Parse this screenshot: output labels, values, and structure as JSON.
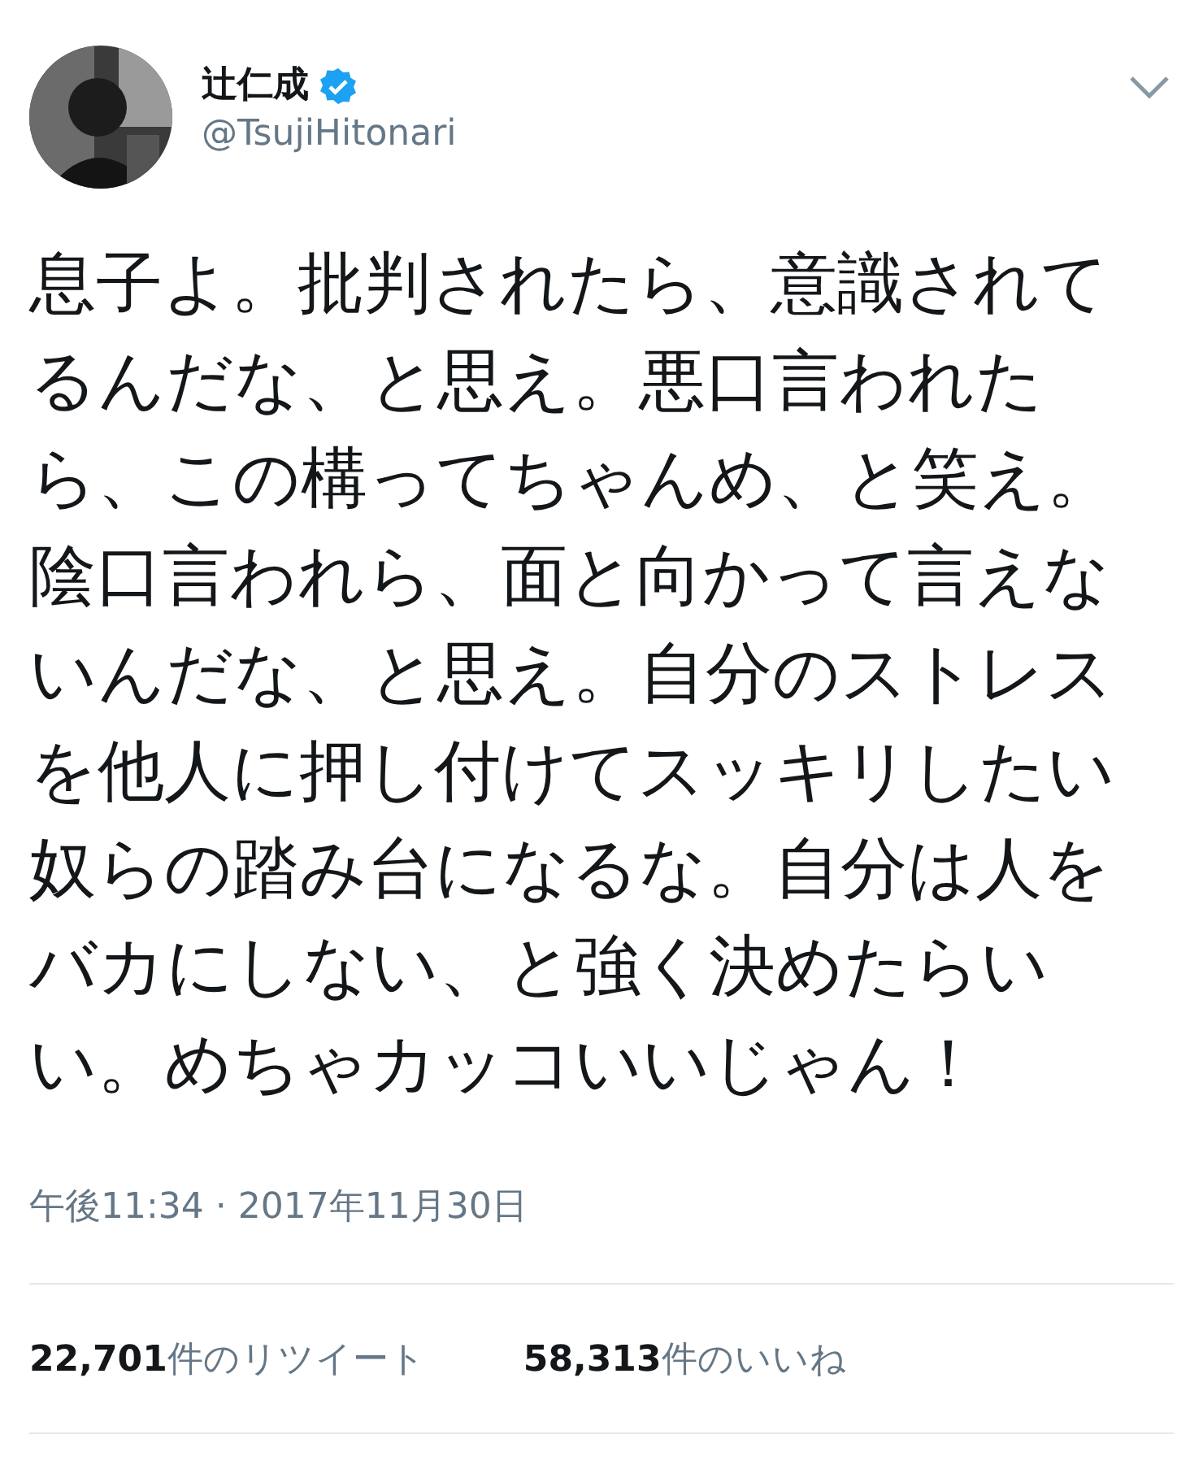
{
  "author": {
    "name": "辻仁成",
    "verified": true,
    "handle": "@TsujiHitonari"
  },
  "tweet": {
    "lines": [
      "息子よ。批判されたら、意識されて",
      "るんだな、と思え。悪口言われた",
      "ら、この構ってちゃんめ、と笑え。",
      "陰口言われら、面と向かって言えな",
      "いんだな、と思え。自分のストレス",
      "を他人に押し付けてスッキリしたい",
      "奴らの踏み台になるな。自分は人を",
      "バカにしない、と強く決めたらい",
      "い。めちゃカッコいいじゃん！"
    ]
  },
  "timestamp": "午後11:34 · 2017年11月30日",
  "stats": [
    {
      "count": "22,701",
      "label": "件のリツイート"
    },
    {
      "count": "58,313",
      "label": "件のいいね"
    }
  ]
}
